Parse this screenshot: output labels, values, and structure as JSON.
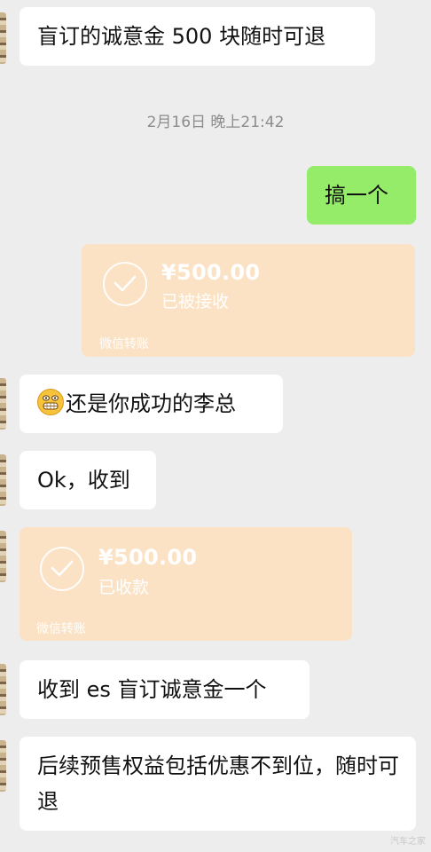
{
  "messages": {
    "m1": "盲订的诚意金 500 块随时可退",
    "timestamp": "2月16日 晚上21:42",
    "m2": "搞一个",
    "m4": "还是你成功的李总",
    "m5": "Ok，收到",
    "m7": "收到 es 盲订诚意金一个",
    "m8": "后续预售权益包括优惠不到位，随时可退"
  },
  "transfers": {
    "t1": {
      "amount": "¥500.00",
      "status": "已被接收",
      "label": "微信转账"
    },
    "t2": {
      "amount": "¥500.00",
      "status": "已收款",
      "label": "微信转账"
    }
  },
  "watermark": "汽车之家",
  "colors": {
    "background": "#ededed",
    "my_bubble": "#95ec69",
    "transfer_card": "#fbe2c5"
  },
  "icons": [
    "check-circle-icon",
    "grinning-emoji-icon"
  ]
}
